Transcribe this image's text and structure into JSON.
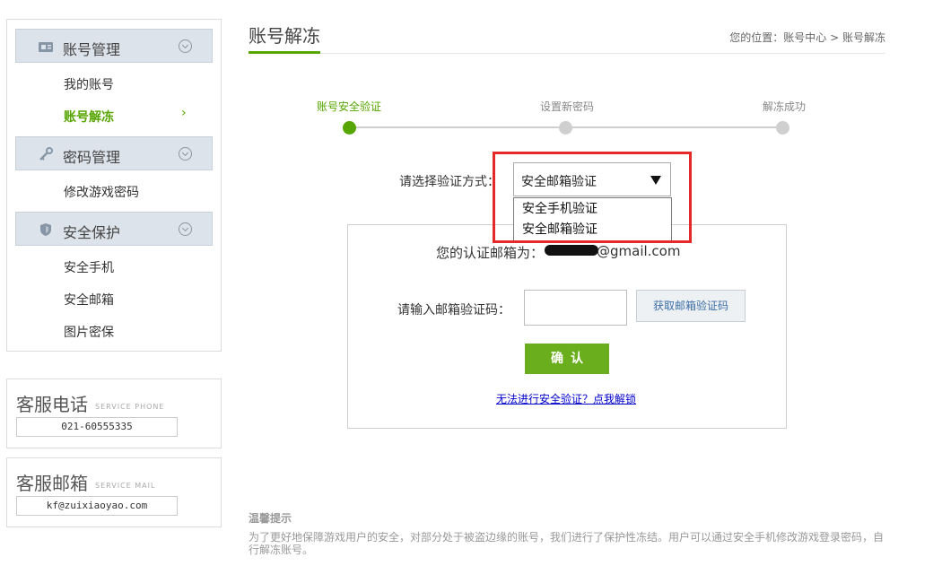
{
  "sidebar": {
    "sections": [
      {
        "title": "账号管理",
        "icon": "id-card-icon",
        "items": [
          {
            "label": "我的账号"
          },
          {
            "label": "账号解冻",
            "active": true
          }
        ]
      },
      {
        "title": "密码管理",
        "icon": "key-icon",
        "items": [
          {
            "label": "修改游戏密码"
          }
        ]
      },
      {
        "title": "安全保护",
        "icon": "shield-icon",
        "items": [
          {
            "label": "安全手机"
          },
          {
            "label": "安全邮箱"
          },
          {
            "label": "图片密保"
          }
        ]
      }
    ],
    "active_arrow": "›",
    "service_phone": {
      "title": "客服电话",
      "sub": "SERVICE PHONE",
      "value": "021-60555335"
    },
    "service_mail": {
      "title": "客服邮箱",
      "sub": "SERVICE MAIL",
      "value": "kf@zuixiaoyao.com"
    }
  },
  "header": {
    "title": "账号解冻",
    "breadcrumb": {
      "prefix": "您的位置：",
      "items": [
        "账号中心",
        "账号解冻"
      ],
      "separator": ">"
    }
  },
  "steps": [
    {
      "label": "账号安全验证",
      "active": true
    },
    {
      "label": "设置新密码",
      "active": false
    },
    {
      "label": "解冻成功",
      "active": false
    }
  ],
  "verify": {
    "label": "请选择验证方式：",
    "selected": "安全邮箱验证",
    "options": [
      "安全手机验证",
      "安全邮箱验证"
    ]
  },
  "form": {
    "email_label": "您的认证邮箱为：",
    "email_domain": "@gmail.com",
    "code_label": "请输入邮箱验证码：",
    "code_value": "",
    "get_code_label": "获取邮箱验证码",
    "confirm_label": "确认",
    "unlock_link": "无法进行安全验证？点我解锁"
  },
  "tips": {
    "title": "温馨提示",
    "text": "为了更好地保障游戏用户的安全，对部分处于被盗边缘的账号，我们进行了保护性冻结。用户可以通过安全手机修改游戏登录密码，自行解冻账号。"
  },
  "colors": {
    "accent": "#56a500",
    "highlight": "#e5292b",
    "link": "#0000cc"
  }
}
